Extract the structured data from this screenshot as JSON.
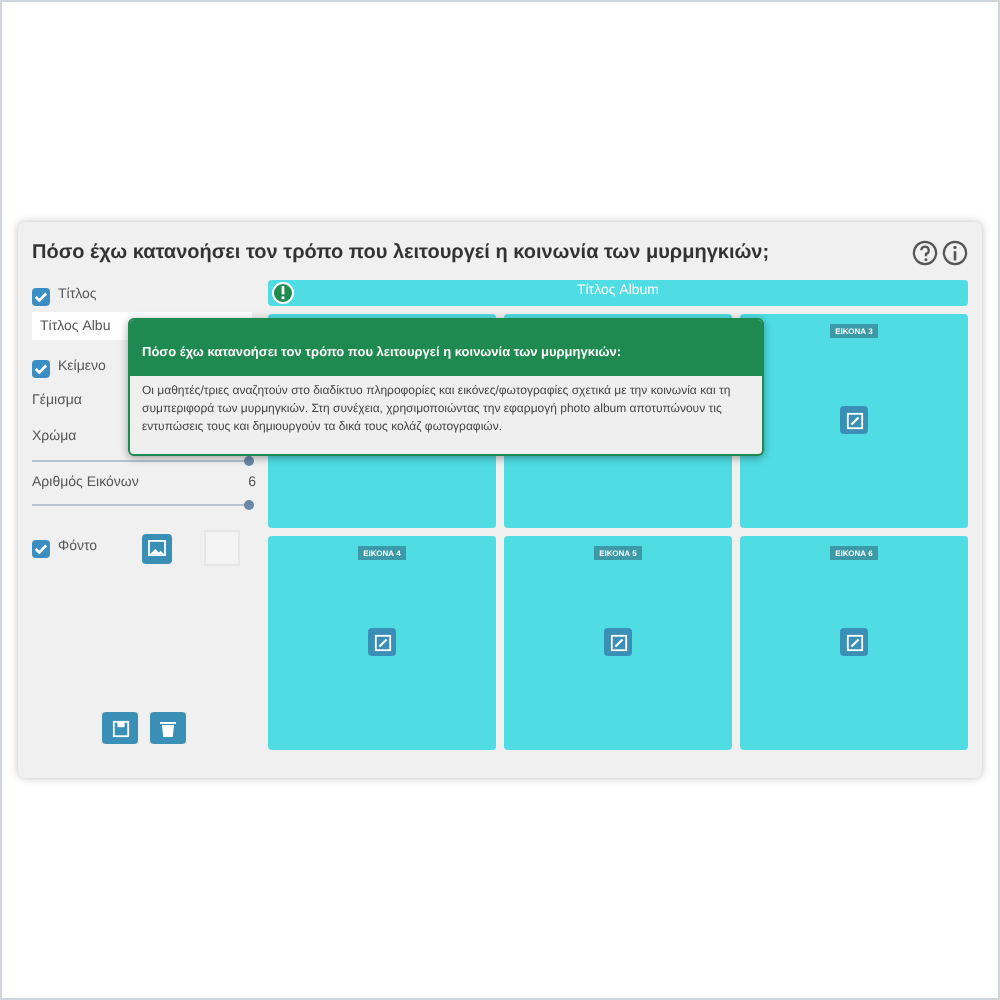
{
  "title": "Πόσο έχω κατανοήσει τον τρόπο που λειτουργεί η κοινωνία των μυρμηγκιών;",
  "sidebar": {
    "controls": [
      {
        "kind": "checkbox",
        "label": "Τίτλος",
        "checked": true
      },
      {
        "kind": "input",
        "value": "Τίτλος Albu"
      },
      {
        "kind": "checkbox",
        "label": "Κείμενο",
        "checked": true
      },
      {
        "kind": "label",
        "label": "Γέμισμα"
      },
      {
        "kind": "slider",
        "label": "Χρώμα",
        "level": 1
      },
      {
        "kind": "slider",
        "label": "Αριθμός Εικόνων",
        "reading": "6",
        "level": 1
      },
      {
        "kind": "background",
        "label": "Φόντο",
        "checked": true
      }
    ]
  },
  "album": {
    "title": "Τίτλος Album",
    "tiles": [
      {
        "label": "ΕΙΚΟΝΑ 3"
      },
      {
        "label": "ΕΙΚΟΝΑ 4"
      },
      {
        "label": "ΕΙΚΟΝΑ 5"
      },
      {
        "label": "ΕΙΚΟΝΑ 6"
      }
    ]
  },
  "tooltip": {
    "title": "Πόσο έχω κατανοήσει τον τρόπο που λειτουργεί η κοινωνία των μυρμηγκιών:",
    "text": "Οι μαθητές/τριες αναζητούν στο διαδίκτυο πληροφορίες και εικόνες/φωτογραφίες σχετικά με την κοινωνία και τη συμπεριφορά των μυρμηγκιών. Στη συνέχεια, χρησιμοποιώντας την εφαρμογή photo album αποτυπώνουν τις εντυπώσεις τους και δημιουργούν τα δικά τους κολάζ φωτογραφιών."
  }
}
